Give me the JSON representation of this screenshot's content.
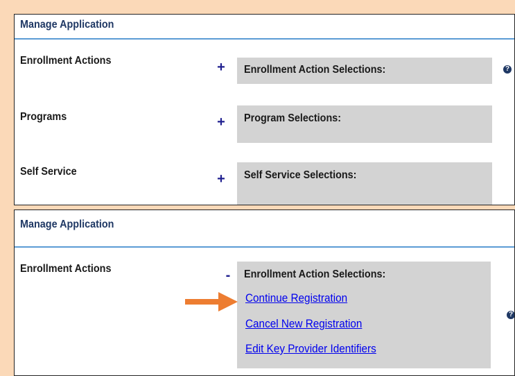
{
  "panel_collapsed": {
    "title": "Manage Application",
    "rows": [
      {
        "label": "Enrollment Actions",
        "toggle": "+",
        "selection_header": "Enrollment Action Selections:"
      },
      {
        "label": "Programs",
        "toggle": "+",
        "selection_header": "Program Selections:"
      },
      {
        "label": "Self Service",
        "toggle": "+",
        "selection_header": "Self Service Selections:"
      }
    ]
  },
  "panel_expanded": {
    "title": "Manage Application",
    "row": {
      "label": "Enrollment Actions",
      "toggle": "-",
      "selection_header": "Enrollment Action Selections:",
      "links": [
        "Continue Registration",
        "Cancel New Registration",
        "Edit Key Provider Identifiers"
      ]
    }
  },
  "help_icon": {
    "name": "help-question-icon",
    "glyph": "?"
  },
  "colors": {
    "background": "#fbd9b8",
    "title": "#1f3864",
    "rule": "#5b9bd5",
    "toggle": "#1f1f8f",
    "selection_box": "#d3d3d3",
    "link": "#0000ee",
    "arrow": "#ed7d31"
  }
}
